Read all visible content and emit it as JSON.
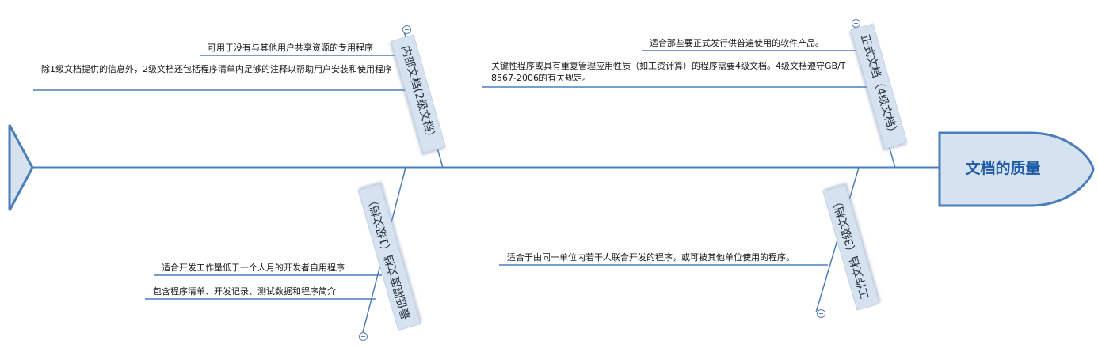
{
  "head": {
    "title": "文档的质量"
  },
  "branches": {
    "internal": {
      "label": "内部文档(2级文档）",
      "notes": [
        "可用于没有与其他用户共享资源的专用程序",
        "除1级文档提供的信息外，2级文档还包括程序清单内足够的注释以帮助用户安装和使用程序"
      ]
    },
    "formal": {
      "label": "正式文档（4级文档）",
      "notes": [
        "适合那些要正式发行供普遍使用的软件产品。",
        "关键性程序或具有重复管理应用性质（如工资计算）的程序需要4级文档。4级文档遵守GB/T 8567-2006的有关规定。"
      ]
    },
    "minimal": {
      "label": "最低限度文档（1级文档）",
      "notes": [
        "适合开发工作量低于一个人月的开发者自用程序",
        "包含程序清单、开发记录、测试数据和程序简介"
      ]
    },
    "working": {
      "label": "工作文档（3级文档）",
      "notes": [
        "适合于由同一单位内若干人联合开发的程序，或可被其他单位使用的程序。"
      ]
    }
  },
  "colors": {
    "spine": "#4a7ebb",
    "label_fill": "#d6e2ef",
    "head_fill": "#d6e2ef",
    "head_text": "#1f5aa6"
  }
}
